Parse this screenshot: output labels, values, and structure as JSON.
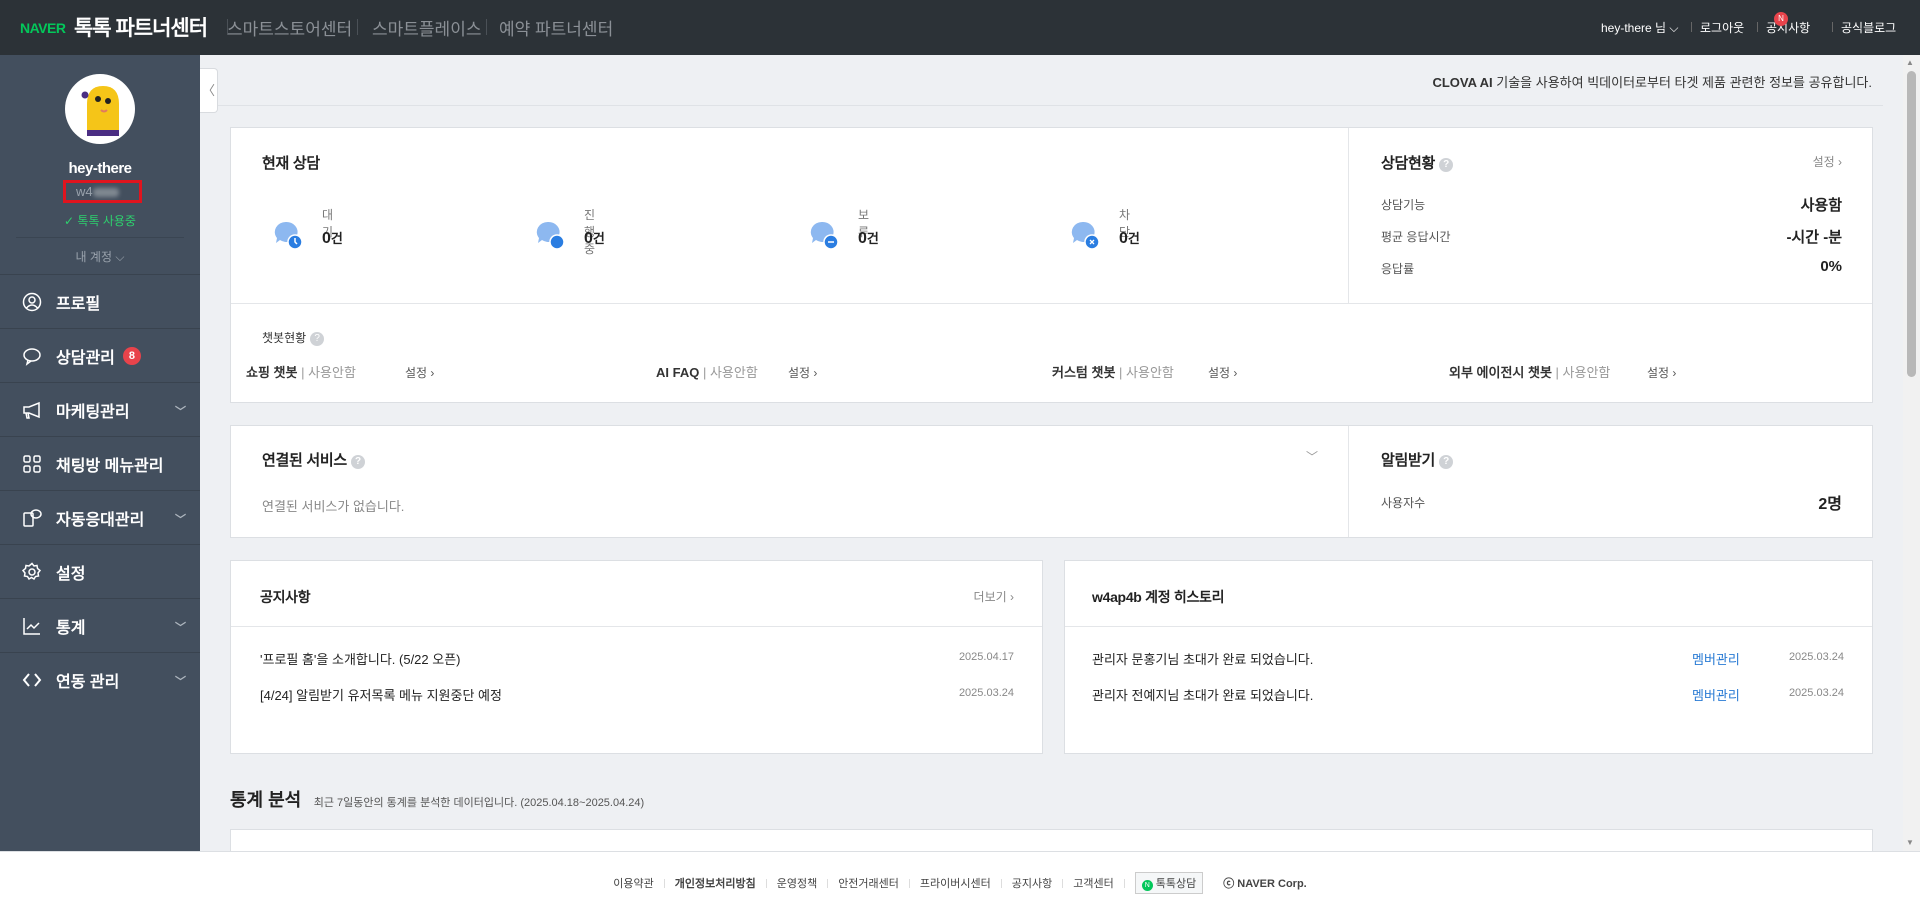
{
  "header": {
    "brand": "NAVER",
    "title": "톡톡 파트너센터",
    "nav": [
      "스마트스토어센터",
      "스마트플레이스",
      "예약 파트너센터"
    ],
    "user": "hey-there 님",
    "logout": "로그아웃",
    "notice": "공지사항",
    "notice_badge": "N",
    "blog": "공식블로그"
  },
  "sidebar": {
    "name": "hey-there",
    "id": "w4",
    "status": "톡톡 사용중",
    "my_account": "내 계정",
    "items": [
      {
        "label": "프로필",
        "icon": "user-icon"
      },
      {
        "label": "상담관리",
        "icon": "chat-icon",
        "badge": "8"
      },
      {
        "label": "마케팅관리",
        "icon": "megaphone-icon",
        "chevron": true
      },
      {
        "label": "채팅방 메뉴관리",
        "icon": "grid-icon"
      },
      {
        "label": "자동응대관리",
        "icon": "auto-reply-icon",
        "chevron": true
      },
      {
        "label": "설정",
        "icon": "gear-icon"
      },
      {
        "label": "통계",
        "icon": "chart-icon",
        "chevron": true
      },
      {
        "label": "연동 관리",
        "icon": "code-icon",
        "chevron": true
      }
    ]
  },
  "clova": {
    "brand": "CLOVA AI",
    "text": " 기술을 사용하여 빅데이터로부터 타겟 제품 관련한 정보를 공유합니다."
  },
  "current": {
    "title": "현재 상담",
    "unit": "건",
    "items": [
      {
        "label": "대기",
        "value": "0",
        "icon": "clock"
      },
      {
        "label": "진행중",
        "value": "0",
        "icon": "dot"
      },
      {
        "label": "보류",
        "value": "0",
        "icon": "minus"
      },
      {
        "label": "차단",
        "value": "0",
        "icon": "x"
      }
    ]
  },
  "chatbot": {
    "title": "챗봇현황",
    "setting": "설정 ›",
    "items": [
      {
        "name": "쇼핑 챗봇",
        "status": "| 사용안함"
      },
      {
        "name": "AI FAQ",
        "status": "| 사용안함"
      },
      {
        "name": "커스텀 챗봇",
        "status": "| 사용안함"
      },
      {
        "name": "외부 에이전시 챗봇",
        "status": "| 사용안함"
      }
    ]
  },
  "status": {
    "title": "상담현황",
    "setting": "설정 ›",
    "rows": [
      {
        "label": "상담기능",
        "value": "사용함"
      },
      {
        "label": "평균 응답시간",
        "value": "-시간 -분"
      },
      {
        "label": "응답률",
        "value": "0%"
      }
    ]
  },
  "connected": {
    "title": "연결된 서비스",
    "empty": "연결된 서비스가 없습니다."
  },
  "alarm": {
    "title": "알림받기",
    "label": "사용자수",
    "value": "2명"
  },
  "notices": {
    "title": "공지사항",
    "more": "더보기 ›",
    "items": [
      {
        "text": "'프로필 홈'을 소개합니다. (5/22 오픈)",
        "date": "2025.04.17"
      },
      {
        "text": "[4/24] 알림받기 유저목록 메뉴 지원중단 예정",
        "date": "2025.03.24"
      }
    ]
  },
  "history": {
    "title": "w4ap4b 계정 히스토리",
    "items": [
      {
        "text": "관리자 문홍기님 초대가 완료 되었습니다.",
        "link": "멤버관리",
        "date": "2025.03.24"
      },
      {
        "text": "관리자 전예지님 초대가 완료 되었습니다.",
        "link": "멤버관리",
        "date": "2025.03.24"
      }
    ]
  },
  "stats": {
    "title": "통계 분석",
    "subtitle": "최근 7일동안의 통계를 분석한 데이터입니다. (2025.04.18~2025.04.24)"
  },
  "footer": {
    "links": [
      "이용약관",
      "개인정보처리방침",
      "운영정책",
      "안전거래센터",
      "프라이버시센터",
      "공지사항",
      "고객센터"
    ],
    "talk": "톡톡상담",
    "corp": "ⓒ NAVER Corp."
  }
}
